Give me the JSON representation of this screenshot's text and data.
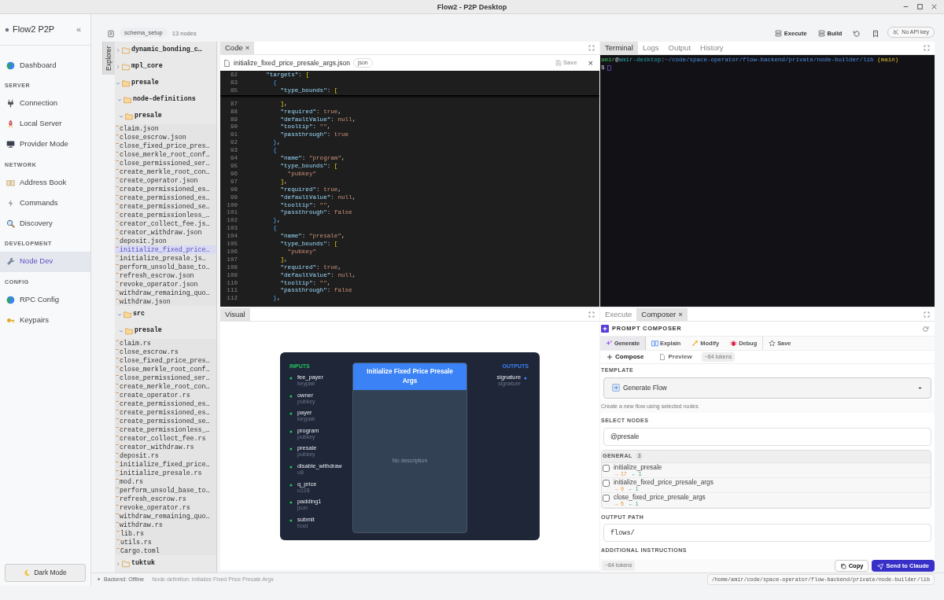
{
  "window": {
    "title": "Flow2 - P2P Desktop"
  },
  "sidebar": {
    "brand": "Flow2 P2P",
    "collapse": "«",
    "sections": [
      {
        "items": [
          {
            "label": "Dashboard",
            "selected": false
          }
        ]
      },
      {
        "heading": "SERVER",
        "items": [
          {
            "label": "Connection",
            "selected": false
          },
          {
            "label": "Local Server",
            "selected": false
          },
          {
            "label": "Provider Mode",
            "selected": false
          }
        ]
      },
      {
        "heading": "NETWORK",
        "items": [
          {
            "label": "Address Book",
            "selected": false
          },
          {
            "label": "Commands",
            "selected": false
          },
          {
            "label": "Discovery",
            "selected": false
          }
        ]
      },
      {
        "heading": "DEVELOPMENT",
        "items": [
          {
            "label": "Node Dev",
            "selected": true
          }
        ]
      },
      {
        "heading": "CONFIG",
        "items": [
          {
            "label": "RPC Config",
            "selected": false
          },
          {
            "label": "Keypairs",
            "selected": false
          }
        ]
      }
    ],
    "theme_button": "Dark Mode"
  },
  "toolbar": {
    "flow": "schema_setup",
    "node_count": "13 nodes",
    "actions": [
      "Execute",
      "Build"
    ],
    "api_status": "No API key"
  },
  "explorer": {
    "tab": "Explorer",
    "tree": [
      {
        "name": "dynamic_bonding_c…",
        "kind": "folder",
        "expanded": false
      },
      {
        "name": "mpl_core",
        "kind": "folder",
        "expanded": false
      },
      {
        "name": "presale",
        "kind": "folder",
        "expanded": true,
        "children": [
          {
            "name": "node-definitions",
            "kind": "folder",
            "expanded": true,
            "children": [
              {
                "name": "presale",
                "kind": "folder",
                "expanded": true,
                "children": [
                  {
                    "name": "claim.json",
                    "kind": "file",
                    "selected": false
                  },
                  {
                    "name": "close_escrow.json",
                    "kind": "file",
                    "selected": false
                  },
                  {
                    "name": "close_fixed_price_pres…",
                    "kind": "file",
                    "selected": false
                  },
                  {
                    "name": "close_merkle_root_conf…",
                    "kind": "file",
                    "selected": false
                  },
                  {
                    "name": "close_permissioned_ser…",
                    "kind": "file",
                    "selected": false
                  },
                  {
                    "name": "create_merkle_root_con…",
                    "kind": "file",
                    "selected": false
                  },
                  {
                    "name": "create_operator.json",
                    "kind": "file",
                    "selected": false
                  },
                  {
                    "name": "create_permissioned_es…",
                    "kind": "file",
                    "selected": false
                  },
                  {
                    "name": "create_permissioned_es…",
                    "kind": "file",
                    "selected": false
                  },
                  {
                    "name": "create_permissioned_se…",
                    "kind": "file",
                    "selected": false
                  },
                  {
                    "name": "create_permissionless_…",
                    "kind": "file",
                    "selected": false
                  },
                  {
                    "name": "creator_collect_fee.js…",
                    "kind": "file",
                    "selected": false
                  },
                  {
                    "name": "creator_withdraw.json",
                    "kind": "file",
                    "selected": false
                  },
                  {
                    "name": "deposit.json",
                    "kind": "file",
                    "selected": false
                  },
                  {
                    "name": "initialize_fixed_price…",
                    "kind": "file",
                    "selected": true
                  },
                  {
                    "name": "initialize_presale.js…",
                    "kind": "file",
                    "selected": false
                  },
                  {
                    "name": "perform_unsold_base_to…",
                    "kind": "file",
                    "selected": false
                  },
                  {
                    "name": "refresh_escrow.json",
                    "kind": "file",
                    "selected": false
                  },
                  {
                    "name": "revoke_operator.json",
                    "kind": "file",
                    "selected": false
                  },
                  {
                    "name": "withdraw_remaining_quo…",
                    "kind": "file",
                    "selected": false
                  },
                  {
                    "name": "withdraw.json",
                    "kind": "file",
                    "selected": false
                  }
                ]
              }
            ]
          },
          {
            "name": "src",
            "kind": "folder",
            "expanded": true,
            "children": [
              {
                "name": "presale",
                "kind": "folder",
                "expanded": true,
                "children": [
                  {
                    "name": "claim.rs",
                    "kind": "file",
                    "selected": false
                  },
                  {
                    "name": "close_escrow.rs",
                    "kind": "file",
                    "selected": false
                  },
                  {
                    "name": "close_fixed_price_pres…",
                    "kind": "file",
                    "selected": false
                  },
                  {
                    "name": "close_merkle_root_conf…",
                    "kind": "file",
                    "selected": false
                  },
                  {
                    "name": "close_permissioned_ser…",
                    "kind": "file",
                    "selected": false
                  },
                  {
                    "name": "create_merkle_root_con…",
                    "kind": "file",
                    "selected": false
                  },
                  {
                    "name": "create_operator.rs",
                    "kind": "file",
                    "selected": false
                  },
                  {
                    "name": "create_permissioned_es…",
                    "kind": "file",
                    "selected": false
                  },
                  {
                    "name": "create_permissioned_es…",
                    "kind": "file",
                    "selected": false
                  },
                  {
                    "name": "create_permissioned_se…",
                    "kind": "file",
                    "selected": false
                  },
                  {
                    "name": "create_permissionless_…",
                    "kind": "file",
                    "selected": false
                  },
                  {
                    "name": "creator_collect_fee.rs",
                    "kind": "file",
                    "selected": false
                  },
                  {
                    "name": "creator_withdraw.rs",
                    "kind": "file",
                    "selected": false
                  },
                  {
                    "name": "deposit.rs",
                    "kind": "file",
                    "selected": false
                  },
                  {
                    "name": "initialize_fixed_price…",
                    "kind": "file",
                    "selected": false
                  },
                  {
                    "name": "initialize_presale.rs",
                    "kind": "file",
                    "selected": false
                  },
                  {
                    "name": "mod.rs",
                    "kind": "file",
                    "selected": false
                  },
                  {
                    "name": "perform_unsold_base_to…",
                    "kind": "file",
                    "selected": false
                  },
                  {
                    "name": "refresh_escrow.rs",
                    "kind": "file",
                    "selected": false
                  },
                  {
                    "name": "revoke_operator.rs",
                    "kind": "file",
                    "selected": false
                  },
                  {
                    "name": "withdraw_remaining_quo…",
                    "kind": "file",
                    "selected": false
                  },
                  {
                    "name": "withdraw.rs",
                    "kind": "file",
                    "selected": false
                  }
                ]
              },
              {
                "name": "lib.rs",
                "kind": "file",
                "selected": false
              },
              {
                "name": "utils.rs",
                "kind": "file",
                "selected": false
              },
              {
                "name": "Cargo.toml",
                "kind": "file",
                "selected": false
              }
            ]
          }
        ]
      },
      {
        "name": "tuktuk",
        "kind": "folder",
        "expanded": false
      }
    ]
  },
  "code_panel": {
    "tabs": [
      {
        "label": "Code",
        "selected": true,
        "close": "×"
      }
    ],
    "file": "initialize_fixed_price_presale_args.json",
    "language": "json",
    "save": {
      "label": "Save",
      "disabled": true
    },
    "close": "×",
    "sticky_lines": [
      {
        "no": "62",
        "text": "    \"targets\": ["
      },
      {
        "no": "83",
        "text": "      {"
      },
      {
        "no": "85",
        "text": "        \"type_bounds\": ["
      }
    ],
    "lines": [
      {
        "no": "87",
        "text": "        ],"
      },
      {
        "no": "88",
        "text": "        \"required\": true,"
      },
      {
        "no": "89",
        "text": "        \"defaultValue\": null,"
      },
      {
        "no": "90",
        "text": "        \"tooltip\": \"\","
      },
      {
        "no": "91",
        "text": "        \"passthrough\": true"
      },
      {
        "no": "92",
        "text": "      },"
      },
      {
        "no": "93",
        "text": "      {"
      },
      {
        "no": "94",
        "text": "        \"name\": \"program\","
      },
      {
        "no": "95",
        "text": "        \"type_bounds\": ["
      },
      {
        "no": "96",
        "text": "          \"pubkey\""
      },
      {
        "no": "97",
        "text": "        ],"
      },
      {
        "no": "98",
        "text": "        \"required\": true,"
      },
      {
        "no": "99",
        "text": "        \"defaultValue\": null,"
      },
      {
        "no": "100",
        "text": "        \"tooltip\": \"\","
      },
      {
        "no": "101",
        "text": "        \"passthrough\": false"
      },
      {
        "no": "102",
        "text": "      },"
      },
      {
        "no": "103",
        "text": "      {"
      },
      {
        "no": "104",
        "text": "        \"name\": \"presale\","
      },
      {
        "no": "105",
        "text": "        \"type_bounds\": ["
      },
      {
        "no": "106",
        "text": "          \"pubkey\""
      },
      {
        "no": "107",
        "text": "        ],"
      },
      {
        "no": "108",
        "text": "        \"required\": true,"
      },
      {
        "no": "109",
        "text": "        \"defaultValue\": null,"
      },
      {
        "no": "110",
        "text": "        \"tooltip\": \"\","
      },
      {
        "no": "111",
        "text": "        \"passthrough\": false"
      },
      {
        "no": "112",
        "text": "      },"
      }
    ]
  },
  "visual_panel": {
    "tabs": [
      {
        "label": "Visual",
        "selected": true
      }
    ],
    "node": {
      "title": "Initialize Fixed Price Presale Args",
      "description": "No description",
      "inputs_label": "INPUTS",
      "outputs_label": "OUTPUTS",
      "inputs": [
        {
          "name": "fee_payer",
          "type": "keypair"
        },
        {
          "name": "owner",
          "type": "pubkey"
        },
        {
          "name": "payer",
          "type": "keypair"
        },
        {
          "name": "program",
          "type": "pubkey"
        },
        {
          "name": "presale",
          "type": "pubkey"
        },
        {
          "name": "disable_withdraw",
          "type": "u8"
        },
        {
          "name": "q_price",
          "type": "u128"
        },
        {
          "name": "padding1",
          "type": "json"
        },
        {
          "name": "submit",
          "type": "bool"
        }
      ],
      "outputs": [
        {
          "name": "signature",
          "type": "signature"
        }
      ]
    }
  },
  "terminal_panel": {
    "tabs": [
      {
        "label": "Terminal",
        "selected": true
      },
      {
        "label": "Logs",
        "selected": false
      },
      {
        "label": "Output",
        "selected": false
      },
      {
        "label": "History",
        "selected": false
      }
    ],
    "prompt": [
      {
        "kind": "user",
        "text": "amir"
      },
      {
        "kind": "punct",
        "text": "@"
      },
      {
        "kind": "host",
        "text": "amir-desktop"
      },
      {
        "kind": "punct",
        "text": ":"
      },
      {
        "kind": "path",
        "text": "~/code/space-operator/flow-backend/private/node-builder/lib"
      },
      {
        "kind": "branch",
        "text": "(main)"
      }
    ],
    "input_prompt": "$"
  },
  "composer_panel": {
    "tabs": [
      {
        "label": "Execute",
        "selected": false
      },
      {
        "label": "Composer",
        "selected": true,
        "close": "×"
      }
    ],
    "title": "PROMPT COMPOSER",
    "modes": [
      {
        "label": "Generate",
        "selected": true
      },
      {
        "label": "Explain",
        "selected": false
      },
      {
        "label": "Modify",
        "selected": false
      },
      {
        "label": "Debug",
        "selected": false
      },
      {
        "label": "Save",
        "selected": false
      }
    ],
    "views": [
      {
        "label": "Compose",
        "selected": true
      },
      {
        "label": "Preview",
        "selected": false
      }
    ],
    "token_estimate": "~84 tokens",
    "template": {
      "label": "TEMPLATE",
      "value": "Generate Flow",
      "description": "Create a new flow using selected nodes"
    },
    "select_nodes": {
      "label": "SELECT NODES",
      "value": "@presale"
    },
    "groups": [
      {
        "name": "GENERAL",
        "count": "3",
        "nodes": [
          {
            "name": "initialize_presale",
            "inputs": "→ 17",
            "outputs": "← 1",
            "checked": false
          },
          {
            "name": "initialize_fixed_price_presale_args",
            "inputs": "→ 9",
            "outputs": "← 1",
            "checked": false
          },
          {
            "name": "close_fixed_price_presale_args",
            "inputs": "→ 5",
            "outputs": "← 1",
            "checked": false
          }
        ]
      }
    ],
    "output_path": {
      "label": "OUTPUT PATH",
      "value": "flows/"
    },
    "instructions_label": "ADDITIONAL INSTRUCTIONS",
    "footer_tokens": "~84 tokens",
    "actions": [
      "Copy",
      "Send to Claude"
    ]
  },
  "status_bar": {
    "backend": "Backend: Offline",
    "online": false,
    "context": "Node definition: Initialize Fixed Price Presale Args",
    "path": "/home/amir/code/space-operator/flow-backend/private/node-builder/lib"
  }
}
